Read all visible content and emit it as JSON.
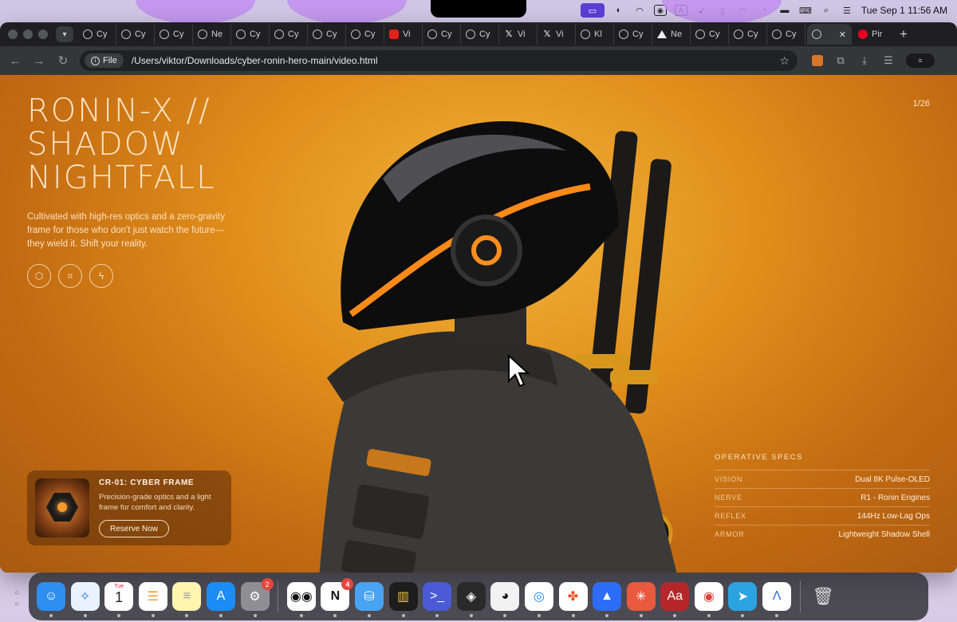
{
  "menubar": {
    "time": "Tue Sep 1  11:56 AM",
    "icons": [
      "screen-share-icon",
      "copilot-icon",
      "arc-icon",
      "camera-icon",
      "text-icon",
      "cursor-tool-icon",
      "phone-icon",
      "headphones-icon",
      "wifi-icon",
      "battery-icon",
      "keyboard-icon",
      "search-icon",
      "control-center-icon"
    ]
  },
  "browser": {
    "tabs": [
      {
        "label": "Cy",
        "fav": "globe"
      },
      {
        "label": "Cy",
        "fav": "globe"
      },
      {
        "label": "Cy",
        "fav": "globe"
      },
      {
        "label": "Ne",
        "fav": "globe"
      },
      {
        "label": "Cy",
        "fav": "globe"
      },
      {
        "label": "Cy",
        "fav": "globe"
      },
      {
        "label": "Cy",
        "fav": "globe"
      },
      {
        "label": "Cy",
        "fav": "globe"
      },
      {
        "label": "Vi",
        "fav": "youtube"
      },
      {
        "label": "Cy",
        "fav": "globe"
      },
      {
        "label": "Cy",
        "fav": "globe"
      },
      {
        "label": "Vi",
        "fav": "x"
      },
      {
        "label": "Vi",
        "fav": "x"
      },
      {
        "label": "Kl",
        "fav": "globe"
      },
      {
        "label": "Cy",
        "fav": "globe"
      },
      {
        "label": "Ne",
        "fav": "triangle"
      },
      {
        "label": "Cy",
        "fav": "globe"
      },
      {
        "label": "Cy",
        "fav": "globe"
      },
      {
        "label": "Cy",
        "fav": "globe"
      }
    ],
    "active_tab_label": "",
    "pinterest_tab": "Pir",
    "file_chip": "File",
    "url": "/Users/viktor/Downloads/cyber-ronin-hero-main/video.html"
  },
  "hero": {
    "title_lines": [
      "RONIN-X //",
      "SHADOW",
      "NIGHTFALL"
    ],
    "description": "Cultivated with high-res optics and a zero-gravity frame for those who don't just watch the future— they wield it. Shift your reality.",
    "slide_counter": "1/26",
    "icon_buttons": [
      "hexagon-icon",
      "focus-icon",
      "bolt-icon"
    ]
  },
  "card": {
    "title": "CR-01: CYBER FRAME",
    "text": "Precision-grade optics and a light frame for comfort and clarity.",
    "button": "Reserve Now"
  },
  "specs": {
    "title": "OPERATIVE SPECS",
    "rows": [
      {
        "key": "VISION",
        "value": "Dual 8K Pulse-OLED"
      },
      {
        "key": "NERVE",
        "value": "R1 - Ronin Engines"
      },
      {
        "key": "REFLEX",
        "value": "144Hz Low-Lag Ops"
      },
      {
        "key": "ARMOR",
        "value": "Lightweight Shadow Shell"
      }
    ]
  },
  "dock": {
    "calendar_day": "Tue",
    "calendar_date": "1",
    "settings_badge": "2",
    "notion_badge": "4"
  },
  "colors": {
    "accent": "#e08d1b",
    "hero_text": "#fbe5c6"
  }
}
